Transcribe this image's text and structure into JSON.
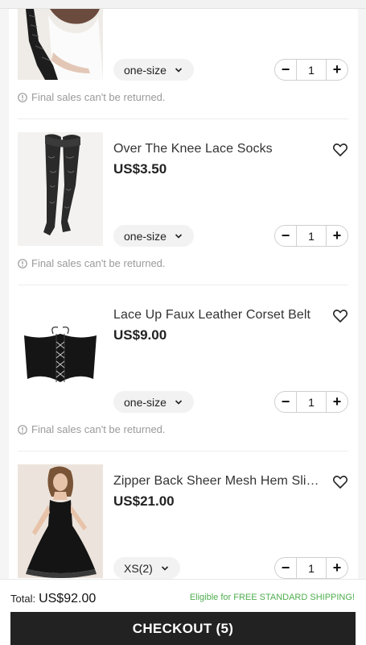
{
  "items": [
    {
      "title": "",
      "price": "",
      "size": "one-size",
      "quantity": "1",
      "notice": "Final sales can't be returned.",
      "image": "lace-gloves-woman-photo"
    },
    {
      "title": "Over The Knee Lace Socks",
      "price": "US$3.50",
      "size": "one-size",
      "quantity": "1",
      "notice": "Final sales can't be returned.",
      "image": "lace-stockings-photo"
    },
    {
      "title": "Lace Up Faux Leather Corset Belt",
      "price": "US$9.00",
      "size": "one-size",
      "quantity": "1",
      "notice": "Final sales can't be returned.",
      "image": "corset-belt-photo"
    },
    {
      "title": "Zipper Back Sheer Mesh Hem Slip...",
      "price": "US$21.00",
      "size": "XS(2)",
      "quantity": "1",
      "notice": "",
      "image": "black-slip-dress-photo"
    }
  ],
  "icons": {
    "minus": "−",
    "plus": "+",
    "heart": "heart-outline-icon",
    "chevron": "chevron-down-icon",
    "info": "info-circle-icon"
  },
  "footer": {
    "total_label": "Total:",
    "total_value": "US$92.00",
    "shipping_note": "Eligible for FREE STANDARD SHIPPING!",
    "checkout_label": "CHECKOUT (5)"
  },
  "colors": {
    "shipping_green": "#4fae4f",
    "checkout_bg": "#222222",
    "muted_text": "#9a9a9a"
  }
}
